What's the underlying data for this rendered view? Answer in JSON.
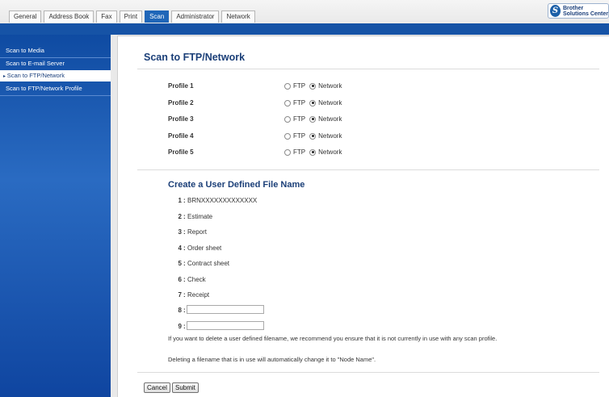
{
  "tabs": [
    {
      "label": "General"
    },
    {
      "label": "Address Book"
    },
    {
      "label": "Fax"
    },
    {
      "label": "Print"
    },
    {
      "label": "Scan"
    },
    {
      "label": "Administrator"
    },
    {
      "label": "Network"
    }
  ],
  "active_tab": "Scan",
  "logo": {
    "line1": "Brother",
    "line2": "Solutions Center"
  },
  "sidebar": {
    "items": [
      {
        "label": "Scan to Media"
      },
      {
        "label": "Scan to E-mail Server"
      },
      {
        "label": "Scan to FTP/Network"
      },
      {
        "label": "Scan to FTP/Network Profile"
      }
    ],
    "active": "Scan to FTP/Network"
  },
  "main": {
    "title": "Scan to FTP/Network",
    "profiles": [
      {
        "label": "Profile 1",
        "selected": "Network"
      },
      {
        "label": "Profile 2",
        "selected": "Network"
      },
      {
        "label": "Profile 3",
        "selected": "Network"
      },
      {
        "label": "Profile 4",
        "selected": "Network"
      },
      {
        "label": "Profile 5",
        "selected": "Network"
      }
    ],
    "option_ftp": "FTP",
    "option_network": "Network",
    "filenames_title": "Create a User Defined File Name",
    "filenames": [
      {
        "num": "1",
        "value": "BRNXXXXXXXXXXXXX"
      },
      {
        "num": "2",
        "value": "Estimate"
      },
      {
        "num": "3",
        "value": "Report"
      },
      {
        "num": "4",
        "value": "Order sheet"
      },
      {
        "num": "5",
        "value": "Contract sheet"
      },
      {
        "num": "6",
        "value": "Check"
      },
      {
        "num": "7",
        "value": "Receipt"
      },
      {
        "num": "8",
        "value": ""
      },
      {
        "num": "9",
        "value": ""
      }
    ],
    "note1": "If you want to delete a user defined filename, we recommend you ensure that it is not currently in use with any scan profile.",
    "note2": "Deleting a filename that is in use will automatically change it to \"Node Name\".",
    "cancel_label": "Cancel",
    "submit_label": "Submit"
  }
}
